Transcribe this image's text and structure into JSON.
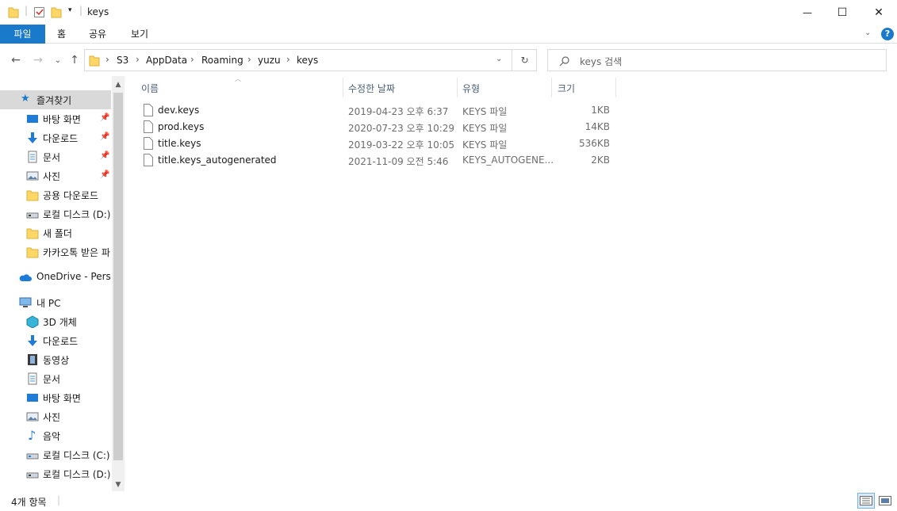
{
  "window": {
    "title": "keys",
    "controls": {
      "minimize": "—",
      "maximize": "☐",
      "close": "✕"
    }
  },
  "ribbon": {
    "tabs": [
      "파일",
      "홈",
      "공유",
      "보기"
    ],
    "help": "?"
  },
  "navigation": {
    "back": "←",
    "forward": "→",
    "recent": "⌄",
    "up": "↑",
    "breadcrumb": [
      "S3",
      "AppData",
      "Roaming",
      "yuzu",
      "keys"
    ],
    "search_placeholder": "keys 검색"
  },
  "sidebar": {
    "quick_access": "즐겨찾기",
    "items": [
      {
        "label": "바탕 화면",
        "icon": "desktop-icon",
        "pinned": true
      },
      {
        "label": "다운로드",
        "icon": "download-icon",
        "pinned": true
      },
      {
        "label": "문서",
        "icon": "document-icon",
        "pinned": true
      },
      {
        "label": "사진",
        "icon": "pictures-icon",
        "pinned": true
      },
      {
        "label": "공용 다운로드",
        "icon": "folder-icon",
        "pinned": false
      },
      {
        "label": "로컬 디스크 (D:)",
        "icon": "drive-icon",
        "pinned": false
      },
      {
        "label": "새 폴더",
        "icon": "folder-icon",
        "pinned": false
      },
      {
        "label": "카카오톡 받은 파",
        "icon": "folder-icon",
        "pinned": false
      }
    ],
    "onedrive": "OneDrive - Personal",
    "this_pc": "내 PC",
    "pc_items": [
      {
        "label": "3D 개체",
        "icon": "3d-objects-icon"
      },
      {
        "label": "다운로드",
        "icon": "download-icon"
      },
      {
        "label": "동영상",
        "icon": "video-icon"
      },
      {
        "label": "문서",
        "icon": "document-icon"
      },
      {
        "label": "바탕 화면",
        "icon": "desktop-icon"
      },
      {
        "label": "사진",
        "icon": "pictures-icon"
      },
      {
        "label": "음악",
        "icon": "music-icon"
      },
      {
        "label": "로컬 디스크 (C:)",
        "icon": "drive-icon"
      },
      {
        "label": "로컬 디스크 (D:)",
        "icon": "drive-icon"
      }
    ]
  },
  "columns": {
    "name": "이름",
    "modified": "수정한 날짜",
    "type": "유형",
    "size": "크기"
  },
  "files": [
    {
      "name": "dev.keys",
      "modified": "2019-04-23 오후 6:37",
      "type": "KEYS 파일",
      "size": "1KB"
    },
    {
      "name": "prod.keys",
      "modified": "2020-07-23 오후 10:29",
      "type": "KEYS 파일",
      "size": "14KB"
    },
    {
      "name": "title.keys",
      "modified": "2019-03-22 오후 10:05",
      "type": "KEYS 파일",
      "size": "536KB"
    },
    {
      "name": "title.keys_autogenerated",
      "modified": "2021-11-09 오전 5:46",
      "type": "KEYS_AUTOGENE...",
      "size": "2KB"
    }
  ],
  "status": {
    "item_count": "4개 항목"
  },
  "colors": {
    "accent": "#1979ca",
    "folder": "#ffd766",
    "selection": "#d9d9d9"
  }
}
